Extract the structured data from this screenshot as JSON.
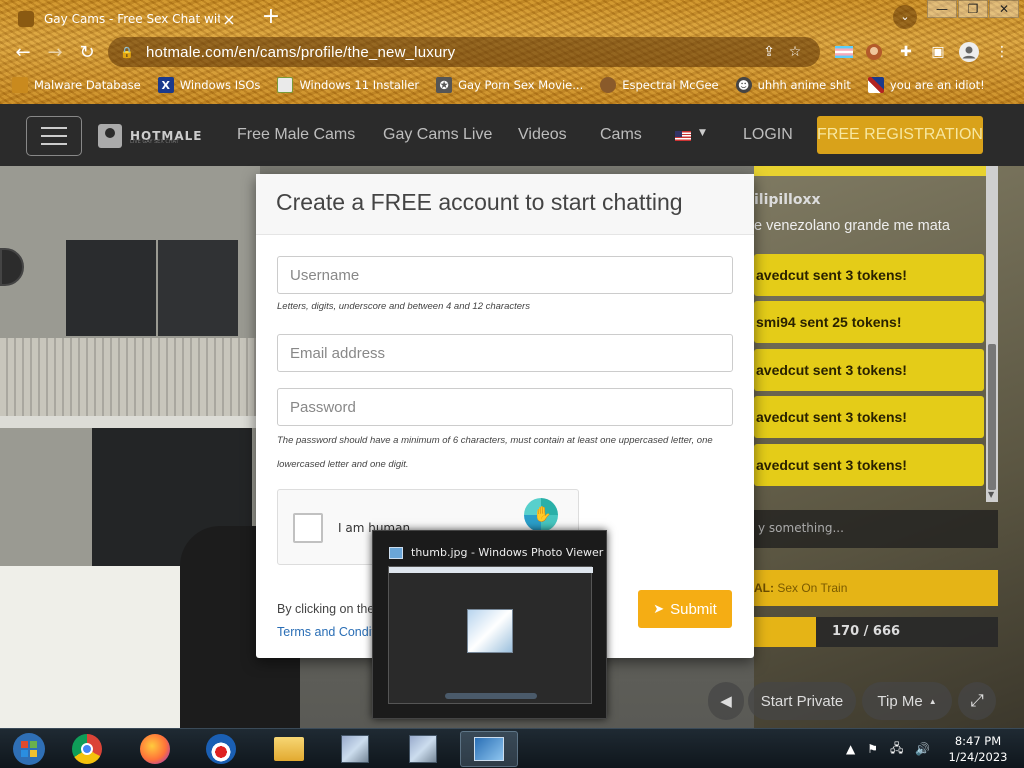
{
  "browser": {
    "tab_title": "Gay Cams - Free Sex Chat with S",
    "url": "hotmale.com/en/cams/profile/the_new_luxury",
    "bookmarks": [
      {
        "label": "Malware Database",
        "icon": "malware-icon",
        "color": "#c98a1e"
      },
      {
        "label": "Windows ISOs",
        "icon": "x-icon",
        "color": "#1b3a8c"
      },
      {
        "label": "Windows 11 Installer",
        "icon": "installer-icon",
        "color": "#7a9a3a"
      },
      {
        "label": "Gay Porn Sex Movie...",
        "icon": "movie-icon",
        "color": "#555555"
      },
      {
        "label": "Espectral McGee",
        "icon": "face-icon",
        "color": "#8a5a2a"
      },
      {
        "label": "uhhh anime shit",
        "icon": "anime-icon",
        "color": "#444444"
      },
      {
        "label": "you are an idiot!",
        "icon": "flag-icon",
        "color": "#b22222"
      }
    ]
  },
  "site": {
    "logo": "HOTMALE",
    "logo_tagline": "LIVE GAY SEX CHAT",
    "menu": [
      "Free Male Cams",
      "Gay Cams Live",
      "Videos",
      "Cams"
    ],
    "login": "LOGIN",
    "register": "FREE REGISTRATION"
  },
  "chat": {
    "username": "ilipilloxx",
    "message": "e venezolano grande me mata",
    "tokens": [
      "avedcut sent 3 tokens!",
      "smi94 sent 25 tokens!",
      "avedcut sent 3 tokens!",
      "avedcut sent 3 tokens!",
      "avedcut sent 3 tokens!"
    ],
    "say_placeholder": "y something...",
    "goal_label": "AL:",
    "goal_text": " Sex On Train",
    "progress_text": "170 / 666",
    "progress_value": 170,
    "progress_max": 666,
    "start_private": "Start Private",
    "tip_me": "Tip Me"
  },
  "modal": {
    "title": "Create a FREE account to start chatting",
    "username_placeholder": "Username",
    "username_help": "Letters, digits, underscore and between 4 and 12 characters",
    "email_placeholder": "Email address",
    "password_placeholder": "Password",
    "password_help": "The password should have a minimum of 6 characters, must contain at least one uppercased letter, one lowercased letter and one digit.",
    "captcha_label": "I am human",
    "terms_prefix": "By clicking on the",
    "terms_link": "Terms and Condit",
    "submit": "Submit"
  },
  "thumbnail": {
    "title": "thumb.jpg - Windows Photo Viewer"
  },
  "taskbar": {
    "time": "8:47 PM",
    "date": "1/24/2023"
  }
}
